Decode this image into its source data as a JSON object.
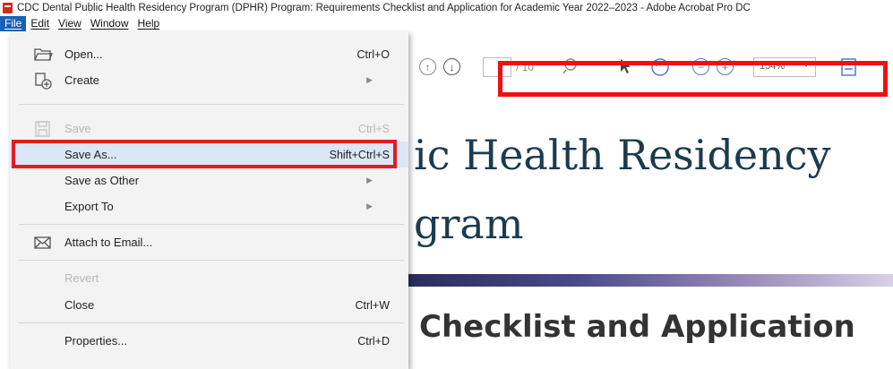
{
  "window": {
    "title": "CDC Dental Public Health Residency Program (DPHR) Program: Requirements Checklist and Application for Academic Year 2022–2023 - Adobe Acrobat Pro DC"
  },
  "menubar": {
    "items": [
      "File",
      "Edit",
      "View",
      "Window",
      "Help"
    ]
  },
  "toolbar": {
    "page_total": "/ 10",
    "zoom": "154%"
  },
  "file_menu": {
    "open": {
      "label": "Open...",
      "shortcut": "Ctrl+O"
    },
    "create": {
      "label": "Create"
    },
    "save": {
      "label": "Save",
      "shortcut": "Ctrl+S"
    },
    "save_as": {
      "label": "Save As...",
      "shortcut": "Shift+Ctrl+S"
    },
    "save_as_other": {
      "label": "Save as Other"
    },
    "export_to": {
      "label": "Export To"
    },
    "attach_email": {
      "label": "Attach to Email..."
    },
    "revert": {
      "label": "Revert"
    },
    "close": {
      "label": "Close",
      "shortcut": "Ctrl+W"
    },
    "properties": {
      "label": "Properties...",
      "shortcut": "Ctrl+D"
    }
  },
  "document": {
    "line1": "ic Health Residency",
    "line2": "gram",
    "line3": "Checklist and Application"
  }
}
